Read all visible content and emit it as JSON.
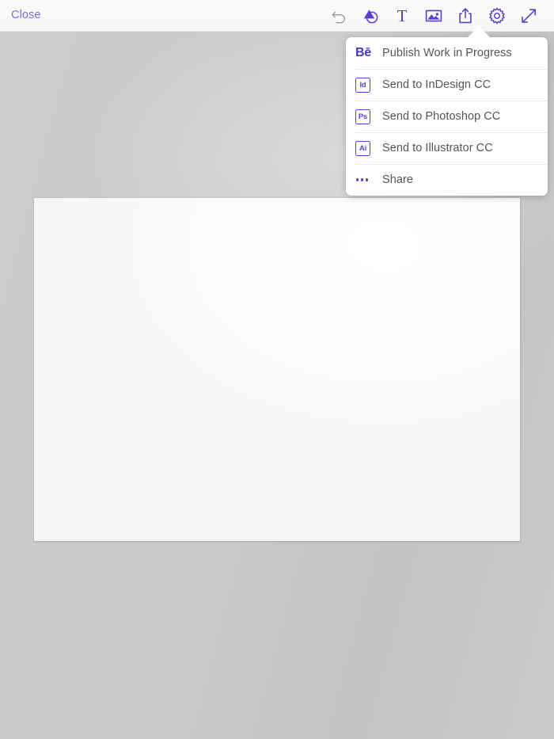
{
  "window": {
    "app_background_color": "#cbcbcb",
    "accent_color": "#5b3fd4"
  },
  "toolbar": {
    "close_label": "Close",
    "close_color": "#7a6ad8",
    "background_color": "#fafafa",
    "icons": [
      {
        "name": "undo-icon",
        "title": "Undo",
        "color": "#9b9b9b"
      },
      {
        "name": "shapes-icon",
        "title": "Shapes",
        "color": "#5b3fd4"
      },
      {
        "name": "text-icon",
        "title": "Text",
        "color": "#5b3fd4"
      },
      {
        "name": "image-icon",
        "title": "Image",
        "color": "#5b3fd4"
      },
      {
        "name": "share-icon",
        "title": "Share",
        "color": "#5b3fd4"
      },
      {
        "name": "gear-icon",
        "title": "Settings",
        "color": "#5b3fd4"
      },
      {
        "name": "expand-icon",
        "title": "Expand",
        "color": "#5b3fd4"
      }
    ]
  },
  "share_menu": {
    "open": true,
    "items": [
      {
        "icon": "behance-icon",
        "icon_text": "Be",
        "label": "Publish Work in Progress"
      },
      {
        "icon": "indesign-icon",
        "icon_text": "Id",
        "label": "Send to InDesign CC"
      },
      {
        "icon": "photoshop-icon",
        "icon_text": "Ps",
        "label": "Send to Photoshop CC"
      },
      {
        "icon": "illustrator-icon",
        "icon_text": "Ai",
        "label": "Send to Illustrator CC"
      },
      {
        "icon": "more-dots-icon",
        "icon_text": "",
        "label": "Share"
      }
    ]
  },
  "canvas": {
    "artboard_color": "#ffffff"
  }
}
